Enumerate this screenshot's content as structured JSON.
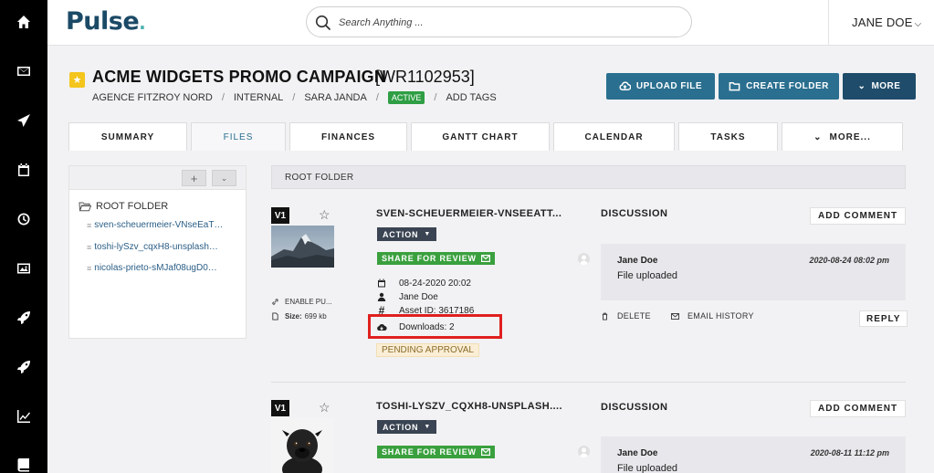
{
  "header": {
    "logo": "Pulse",
    "search_placeholder": "Search Anything ...",
    "user_name": "JANE DOE"
  },
  "project": {
    "title": "ACME WIDGETS PROMO CAMPAIGN",
    "code": "[WR1102953]",
    "client": "AGENCE FITZROY NORD",
    "type": "INTERNAL",
    "owner": "SARA JANDA",
    "status": "ACTIVE",
    "add_tags": "ADD TAGS"
  },
  "actions": {
    "upload": "UPLOAD FILE",
    "create_folder": "CREATE FOLDER",
    "more": "MORE"
  },
  "tabs": [
    "SUMMARY",
    "FILES",
    "FINANCES",
    "GANTT CHART",
    "CALENDAR",
    "TASKS",
    "MORE..."
  ],
  "tree": {
    "root": "ROOT FOLDER",
    "files": [
      "sven-scheuermeier-VNseEaT…",
      "toshi-lySzv_cqxH8-unsplash…",
      "nicolas-prieto-sMJaf08ugD0…"
    ]
  },
  "breadcrumb": "ROOT FOLDER",
  "files": [
    {
      "version": "V1",
      "name": "SVEN-SCHEUERMEIER-VNSEEATT...",
      "action": "ACTION",
      "share": "SHARE FOR REVIEW",
      "enable_public": "ENABLE PU...",
      "size_label": "Size:",
      "size": "699 kb",
      "date": "08-24-2020 20:02",
      "uploader": "Jane Doe",
      "asset_id": "Asset ID: 3617186",
      "downloads": "Downloads: 2",
      "approval": "PENDING APPROVAL",
      "discussion": {
        "title": "DISCUSSION",
        "add_comment": "ADD COMMENT",
        "author": "Jane Doe",
        "date": "2020-08-24 08:02 pm",
        "message": "File uploaded",
        "delete": "DELETE",
        "email_history": "EMAIL HISTORY",
        "reply": "REPLY"
      }
    },
    {
      "version": "V1",
      "name": "TOSHI-LYSZV_CQXH8-UNSPLASH....",
      "action": "ACTION",
      "share": "SHARE FOR REVIEW",
      "discussion": {
        "title": "DISCUSSION",
        "add_comment": "ADD COMMENT",
        "author": "Jane Doe",
        "date": "2020-08-11 11:12 pm",
        "message": "File uploaded"
      }
    }
  ],
  "colors": {
    "primary": "#2a6f8f",
    "primary_dark": "#1f4c6a",
    "active_green": "#2f9e44",
    "highlight": "#e01f1f"
  }
}
